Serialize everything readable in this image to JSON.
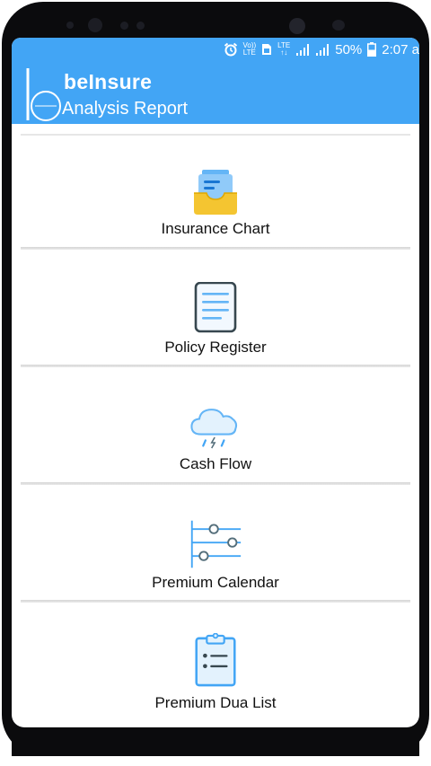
{
  "status_bar": {
    "volte_top": "Vo))",
    "volte_bottom": "LTE",
    "lte_label": "LTE",
    "battery": "50%",
    "time": "2:07 a"
  },
  "app_bar": {
    "title": "beInsure",
    "subtitle": "Analysis Report"
  },
  "colors": {
    "accent": "#42a5f5",
    "phone_frame": "#0b0b0d"
  },
  "menu": {
    "items": [
      {
        "label": "Insurance Chart",
        "icon": "inbox-tray-icon"
      },
      {
        "label": "Policy Register",
        "icon": "document-icon"
      },
      {
        "label": "Cash Flow",
        "icon": "rain-cloud-icon"
      },
      {
        "label": "Premium Calendar",
        "icon": "sliders-icon"
      },
      {
        "label": "Premium Dua List",
        "icon": "clipboard-icon"
      }
    ]
  }
}
